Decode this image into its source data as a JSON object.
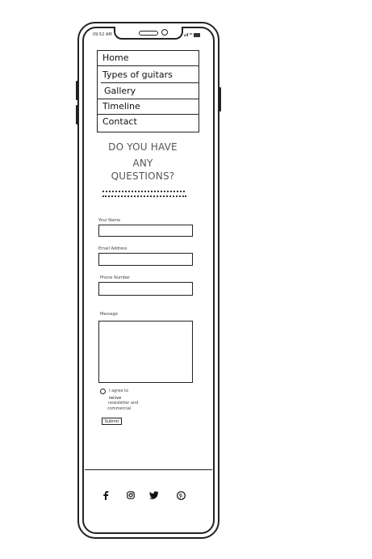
{
  "status_bar": {
    "time": "09:52 AM"
  },
  "nav": {
    "items": [
      "Home",
      "Types of guitars",
      "Gallery",
      "Timeline",
      "Contact"
    ]
  },
  "headline": {
    "line1": "DO YOU HAVE",
    "line2": "ANY",
    "line3": "QUESTIONS?"
  },
  "form": {
    "name_label": "Your Name",
    "email_label": "Email Address",
    "phone_label": "Phone Number",
    "message_label": "Message",
    "agree_line1": "I agree to",
    "agree_line2": "recive",
    "agree_line3": "newsletter and",
    "agree_line4": "commercial",
    "submit_label": "Submit"
  },
  "footer": {
    "icons": [
      "facebook-icon",
      "instagram-icon",
      "twitter-icon",
      "pinterest-icon"
    ]
  },
  "colors": {
    "ink": "#222222",
    "headline": "#555555",
    "background": "#ffffff"
  }
}
